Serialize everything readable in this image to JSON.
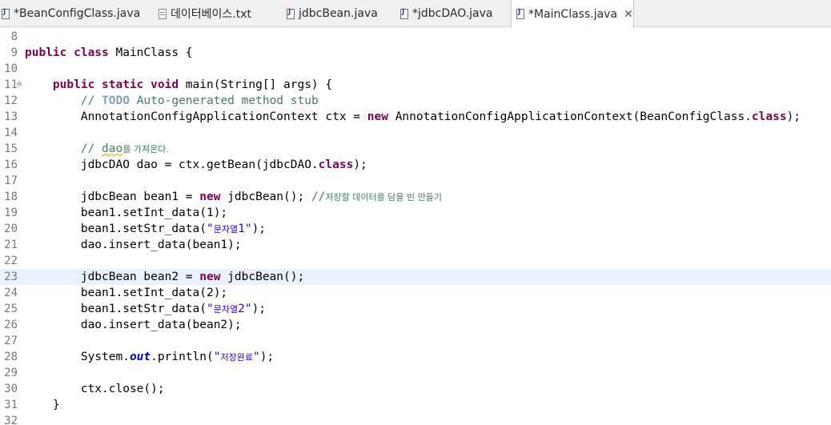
{
  "tabs": [
    {
      "label": "*BeanConfigClass.java",
      "icon": "java-file-icon"
    },
    {
      "label": "데이터베이스.txt",
      "icon": "text-file-icon"
    },
    {
      "label": "jdbcBean.java",
      "icon": "java-file-icon"
    },
    {
      "label": "*jdbcDAO.java",
      "icon": "java-file-icon"
    },
    {
      "label": "*MainClass.java",
      "icon": "java-file-icon",
      "active": true,
      "close": "✕"
    }
  ],
  "editor": {
    "current_line": 23,
    "lines": [
      {
        "n": "8",
        "tokens": []
      },
      {
        "n": "9",
        "tokens": [
          [
            "kw",
            "public class"
          ],
          [
            "",
            " MainClass {"
          ]
        ]
      },
      {
        "n": "10",
        "tokens": []
      },
      {
        "n": "11",
        "fold": "⊖",
        "tokens": [
          [
            "",
            "    "
          ],
          [
            "kw",
            "public static void"
          ],
          [
            "",
            " main(String[] args) {"
          ]
        ]
      },
      {
        "n": "12",
        "tokens": [
          [
            "",
            "        "
          ],
          [
            "cm",
            "// "
          ],
          [
            "todo",
            "TODO"
          ],
          [
            "cm",
            " Auto-generated method stub"
          ]
        ]
      },
      {
        "n": "13",
        "tokens": [
          [
            "",
            "        AnnotationConfigApplicationContext ctx = "
          ],
          [
            "kw",
            "new"
          ],
          [
            "",
            " AnnotationConfigApplicationContext(BeanConfigClass."
          ],
          [
            "kw",
            "class"
          ],
          [
            "",
            ");"
          ]
        ]
      },
      {
        "n": "14",
        "tokens": []
      },
      {
        "n": "15",
        "tokens": [
          [
            "",
            "        "
          ],
          [
            "cm",
            "// "
          ],
          [
            "cm squig",
            "dao"
          ],
          [
            "cm kr",
            "를 가져온다."
          ]
        ]
      },
      {
        "n": "16",
        "tokens": [
          [
            "",
            "        jdbcDAO dao = ctx.getBean(jdbcDAO."
          ],
          [
            "kw",
            "class"
          ],
          [
            "",
            ");"
          ]
        ]
      },
      {
        "n": "17",
        "tokens": []
      },
      {
        "n": "18",
        "tokens": [
          [
            "",
            "        jdbcBean bean1 = "
          ],
          [
            "kw",
            "new"
          ],
          [
            "",
            " jdbcBean(); "
          ],
          [
            "cm",
            "//"
          ],
          [
            "cm kr",
            "저장할 데이터를 담을 빈 만들기"
          ]
        ]
      },
      {
        "n": "19",
        "tokens": [
          [
            "",
            "        bean1.setInt_data(1);"
          ]
        ]
      },
      {
        "n": "20",
        "tokens": [
          [
            "",
            "        bean1.setStr_data("
          ],
          [
            "str",
            "\""
          ],
          [
            "str kr",
            "문자열"
          ],
          [
            "str",
            "1\""
          ],
          [
            "",
            ");"
          ]
        ]
      },
      {
        "n": "21",
        "tokens": [
          [
            "",
            "        dao.insert_data(bean1);"
          ]
        ]
      },
      {
        "n": "22",
        "tokens": []
      },
      {
        "n": "23",
        "tokens": [
          [
            "",
            "        jdbcBean bean2 = "
          ],
          [
            "kw",
            "new"
          ],
          [
            "",
            " jdbcBean();"
          ]
        ]
      },
      {
        "n": "24",
        "tokens": [
          [
            "",
            "        bean1.setInt_data(2);"
          ]
        ]
      },
      {
        "n": "25",
        "tokens": [
          [
            "",
            "        bean1.setStr_data("
          ],
          [
            "str",
            "\""
          ],
          [
            "str kr",
            "문자열"
          ],
          [
            "str",
            "2\""
          ],
          [
            "",
            ");"
          ]
        ]
      },
      {
        "n": "26",
        "tokens": [
          [
            "",
            "        dao.insert_data(bean2);"
          ]
        ]
      },
      {
        "n": "27",
        "tokens": []
      },
      {
        "n": "28",
        "tokens": [
          [
            "",
            "        System."
          ],
          [
            "sfld",
            "out"
          ],
          [
            "",
            ".println("
          ],
          [
            "str",
            "\""
          ],
          [
            "str kr",
            "저장완료"
          ],
          [
            "str",
            "\""
          ],
          [
            "",
            ");"
          ]
        ]
      },
      {
        "n": "29",
        "tokens": []
      },
      {
        "n": "30",
        "tokens": [
          [
            "",
            "        ctx.close();"
          ]
        ]
      },
      {
        "n": "31",
        "tokens": [
          [
            "",
            "    }"
          ]
        ]
      },
      {
        "n": "32",
        "tokens": []
      }
    ]
  }
}
